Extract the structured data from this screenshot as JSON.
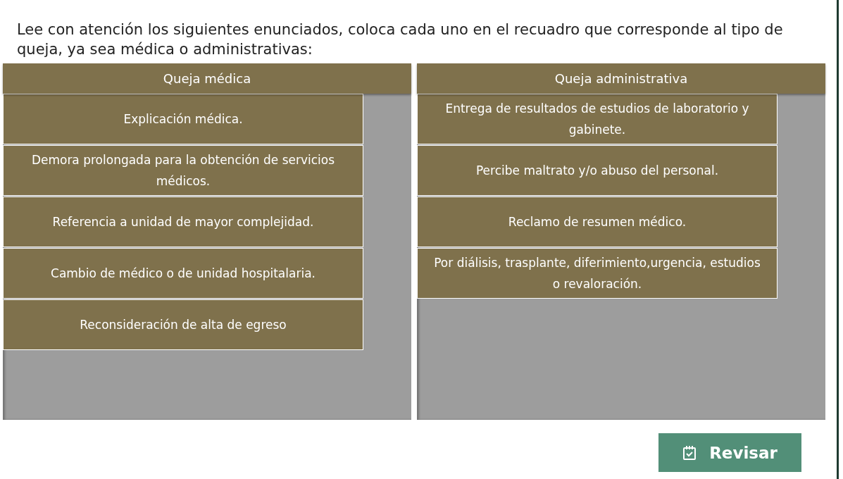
{
  "instructions": "Lee con atención los siguientes enunciados, coloca cada uno en el recuadro que corresponde al tipo de queja, ya sea médica o administrativas:",
  "columns": [
    {
      "title": "Queja médica",
      "cards": [
        "Explicación médica.",
        "Demora prolongada para la obtención de servicios médicos.",
        "Referencia a unidad de mayor complejidad.",
        "Cambio de médico o de unidad hospitalaria.",
        "Reconsideración de alta de egreso"
      ]
    },
    {
      "title": "Queja administrativa",
      "cards": [
        "Entrega de resultados de estudios de laboratorio y gabinete.",
        "Percibe maltrato y/o abuso del personal.",
        "Reclamo de resumen médico.",
        "Por diálisis, trasplante, diferimiento,urgencia, estudios o revaloración."
      ]
    }
  ],
  "button": {
    "label": "Revisar"
  }
}
